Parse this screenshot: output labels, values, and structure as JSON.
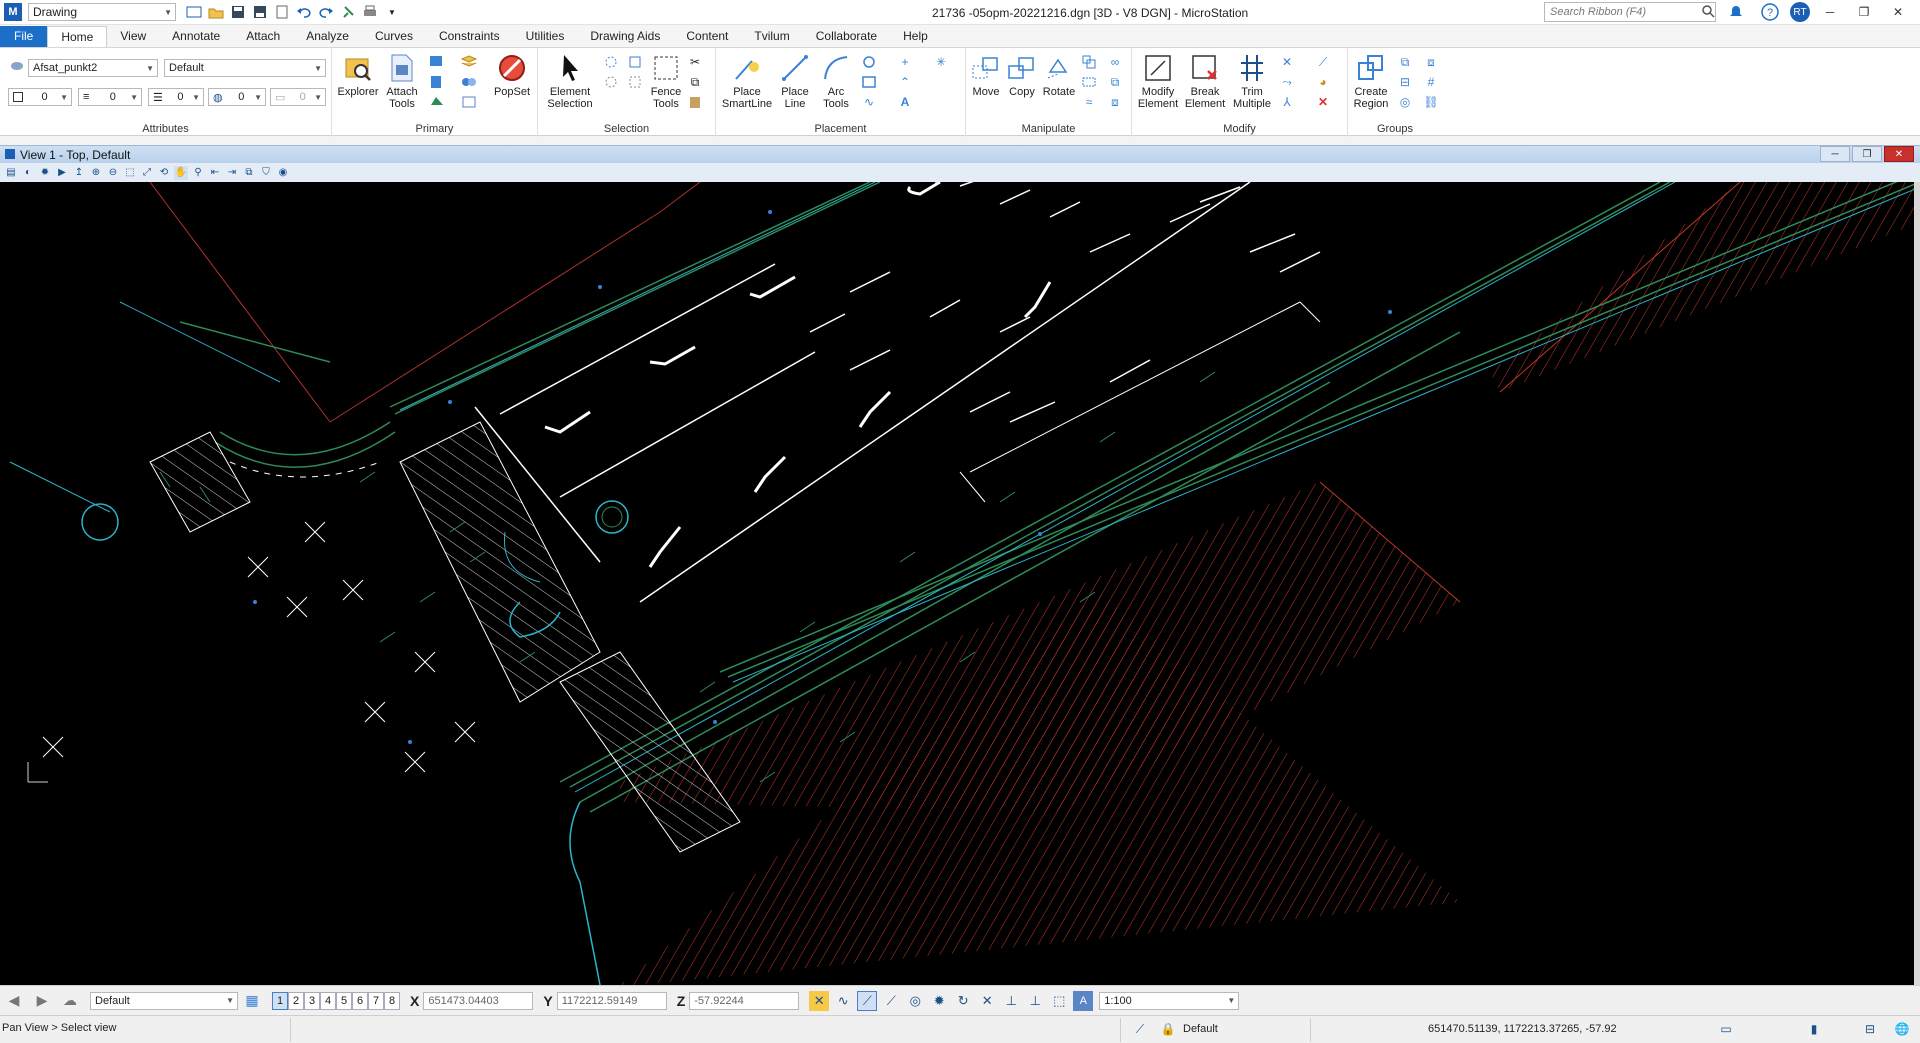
{
  "title_bar": {
    "workspace_value": "Drawing",
    "document_title": "21736 -05opm-20221216.dgn [3D - V8 DGN] - MicroStation",
    "search_placeholder": "Search Ribbon (F4)",
    "user_initials": "RT"
  },
  "tabs": [
    "File",
    "Home",
    "View",
    "Annotate",
    "Attach",
    "Analyze",
    "Curves",
    "Constraints",
    "Utilities",
    "Drawing Aids",
    "Content",
    "Tvilum",
    "Collaborate",
    "Help"
  ],
  "active_tab": "Home",
  "ribbon": {
    "attributes": {
      "label": "Attributes",
      "level_value": "Afsat_punkt2",
      "style_value": "Default",
      "color_value": "0",
      "linestyle_value": "0",
      "weight_value": "0",
      "transparency_value": "0",
      "priority_value": "0"
    },
    "primary": {
      "label": "Primary",
      "explorer": "Explorer",
      "attach_tools": "Attach Tools",
      "popset": "PopSet"
    },
    "selection": {
      "label": "Selection",
      "element_selection": "Element Selection",
      "fence_tools": "Fence Tools"
    },
    "placement": {
      "label": "Placement",
      "place_smartline": "Place SmartLine",
      "place_line": "Place Line",
      "arc_tools": "Arc Tools"
    },
    "manipulate": {
      "label": "Manipulate",
      "move": "Move",
      "copy": "Copy",
      "rotate": "Rotate"
    },
    "modify": {
      "label": "Modify",
      "modify_element": "Modify Element",
      "break_element": "Break Element",
      "trim_multiple": "Trim Multiple"
    },
    "groups": {
      "label": "Groups",
      "create_region": "Create Region"
    }
  },
  "view": {
    "title": "View 1 - Top, Default"
  },
  "bottom_toolbar": {
    "level_value": "Default",
    "view_numbers": [
      "1",
      "2",
      "3",
      "4",
      "5",
      "6",
      "7",
      "8"
    ],
    "active_view": "1",
    "x_label": "X",
    "x_value": "651473.04403",
    "y_label": "Y",
    "y_value": "1172212.59149",
    "z_label": "Z",
    "z_value": "-57.92244",
    "scale_value": "1:100"
  },
  "status_bar": {
    "prompt": "Pan View > Select view",
    "active_level": "Default",
    "coordinates": "651470.51139, 1172213.37265, -57.92"
  },
  "colors": {
    "file_tab": "#1b6fc8",
    "canvas_bg": "#000000",
    "road_lines": "#2e8b57",
    "hatch": "#c0392b"
  }
}
